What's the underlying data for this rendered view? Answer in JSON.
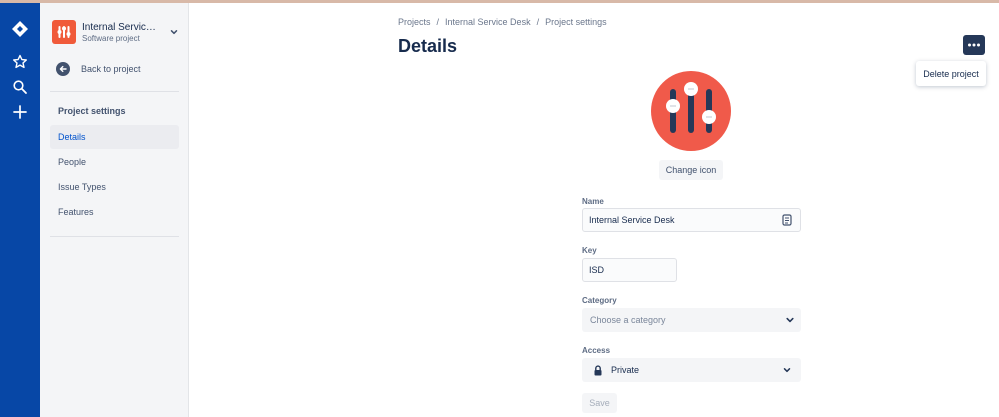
{
  "project": {
    "name": "Internal Service ...",
    "type": "Software project"
  },
  "sidebar": {
    "back_label": "Back to project",
    "section_title": "Project settings",
    "items": [
      {
        "label": "Details",
        "active": true
      },
      {
        "label": "People",
        "active": false
      },
      {
        "label": "Issue Types",
        "active": false
      },
      {
        "label": "Features",
        "active": false
      }
    ]
  },
  "breadcrumbs": [
    "Projects",
    "/",
    "Internal Service Desk",
    "/",
    "Project settings"
  ],
  "page": {
    "title": "Details",
    "more_menu": {
      "item": "Delete project"
    },
    "change_icon_label": "Change icon"
  },
  "form": {
    "name": {
      "label": "Name",
      "value": "Internal Service Desk"
    },
    "key": {
      "label": "Key",
      "value": "ISD"
    },
    "category": {
      "label": "Category",
      "placeholder": "Choose a category"
    },
    "access": {
      "label": "Access",
      "value": "Private"
    },
    "save_label": "Save"
  },
  "colors": {
    "global_nav": "#0747a6",
    "project_avatar": "#f05a3a",
    "link": "#0052cc"
  }
}
